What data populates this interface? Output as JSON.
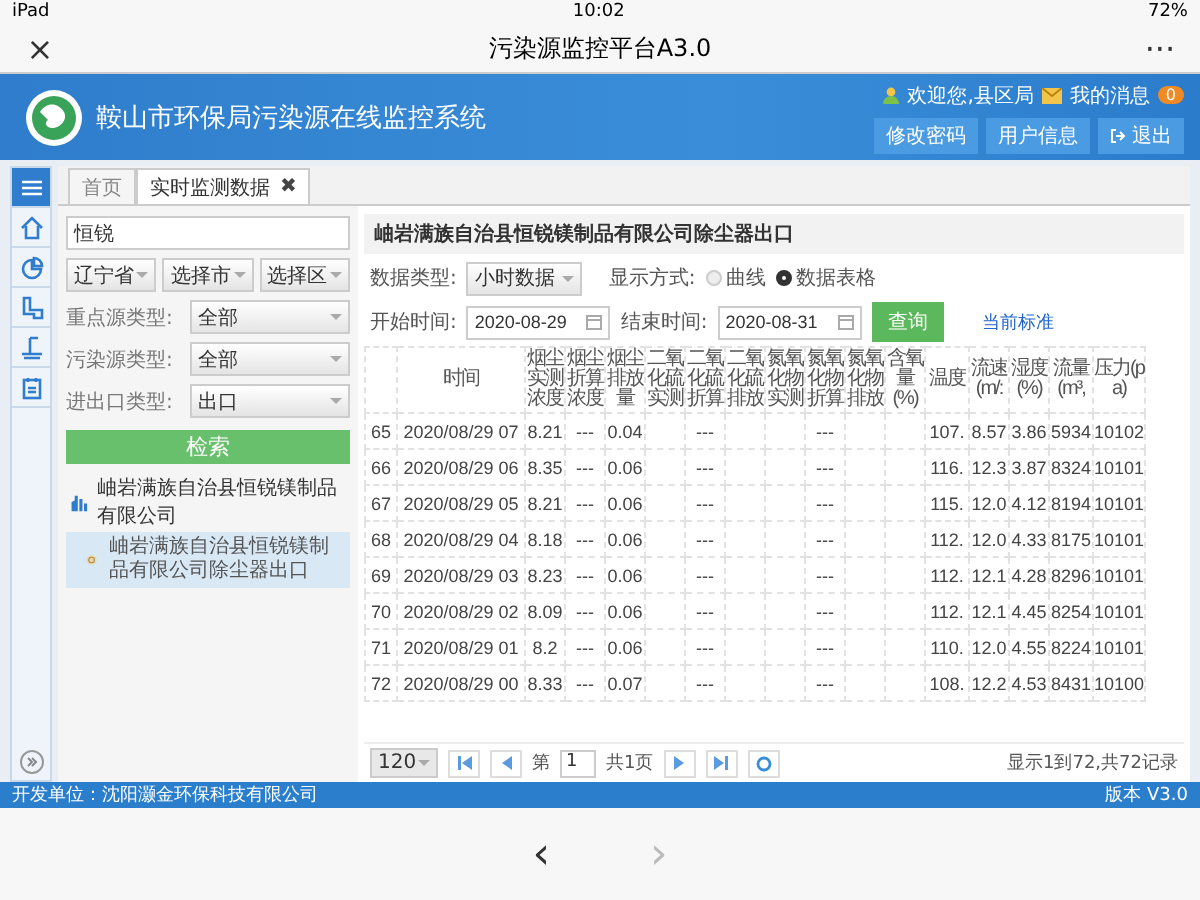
{
  "status_bar": {
    "device": "iPad",
    "time": "10:02",
    "battery": "72%"
  },
  "nav_bar": {
    "close": "×",
    "title": "污染源监控平台A3.0",
    "more": "···"
  },
  "header": {
    "title": "鞍山市环保局污染源在线监控系统",
    "welcome": "欢迎您,县区局",
    "messages": "我的消息",
    "message_count": "0",
    "buttons": [
      {
        "label": "修改密码",
        "kind": "plain"
      },
      {
        "label": "用户信息",
        "kind": "plain"
      },
      {
        "label": "退出",
        "kind": "logout"
      }
    ]
  },
  "rail": [
    {
      "kind": "menu",
      "selected": true
    },
    {
      "kind": "home",
      "selected": false
    },
    {
      "kind": "chart",
      "selected": false
    },
    {
      "kind": "pipe",
      "selected": false
    },
    {
      "kind": "flow",
      "selected": false
    },
    {
      "kind": "calendar",
      "selected": false
    }
  ],
  "tabs": [
    {
      "label": "首页",
      "selected": false
    },
    {
      "label": "实时监测数据",
      "selected": true,
      "close": "✖"
    }
  ],
  "filter": {
    "search": "恒锐",
    "region": [
      "辽宁省",
      "选择市",
      "选择区"
    ],
    "fields": [
      {
        "label": "重点源类型:",
        "value": "全部"
      },
      {
        "label": "污染源类型:",
        "value": "全部"
      },
      {
        "label": "进出口类型:",
        "value": "出口"
      }
    ],
    "button": "检索"
  },
  "tree": [
    {
      "label": "岫岩满族自治县恒锐镁制品有限公司",
      "children": [
        {
          "label": "岫岩满族自治县恒锐镁制品有限公司除尘器出口",
          "selected": true
        }
      ]
    }
  ],
  "panel_title": "岫岩满族自治县恒锐镁制品有限公司除尘器出口",
  "data_type": {
    "label": "数据类型:",
    "value": "小时数据"
  },
  "display": {
    "label": "显示方式:",
    "options": [
      {
        "label": "曲线",
        "selected": false
      },
      {
        "label": "数据表格",
        "selected": true
      }
    ]
  },
  "start": {
    "label": "开始时间:",
    "value": "2020-08-29"
  },
  "end": {
    "label": "结束时间:",
    "value": "2020-08-31"
  },
  "query": "查询",
  "standard_link": "当前标准",
  "table": {
    "columns": [
      "时间",
      "烟尘实测浓度",
      "烟尘折算浓度",
      "烟尘排放量",
      "二氧化硫实测",
      "二氧化硫折算",
      "二氧化硫排放",
      "氮氧化物实测",
      "氮氧化物折算",
      "氮氧化物排放",
      "含氧量(%)",
      "温度",
      "流速(m/:",
      "湿度(%)",
      "流量(m³,",
      "压力(pa)"
    ],
    "rows": [
      {
        "index": "65",
        "cells": [
          "2020/08/29 07",
          "8.21",
          "---",
          "0.04",
          null,
          "---",
          null,
          null,
          "---",
          null,
          null,
          "107.",
          "8.57",
          "3.86",
          "5934",
          "10102"
        ]
      },
      {
        "index": "66",
        "cells": [
          "2020/08/29 06",
          "8.35",
          "---",
          "0.06",
          null,
          "---",
          null,
          null,
          "---",
          null,
          null,
          "116.",
          "12.3",
          "3.87",
          "8324",
          "10101"
        ]
      },
      {
        "index": "67",
        "cells": [
          "2020/08/29 05",
          "8.21",
          "---",
          "0.06",
          null,
          "---",
          null,
          null,
          "---",
          null,
          null,
          "115.",
          "12.0",
          "4.12",
          "8194",
          "10101"
        ]
      },
      {
        "index": "68",
        "cells": [
          "2020/08/29 04",
          "8.18",
          "---",
          "0.06",
          null,
          "---",
          null,
          null,
          "---",
          null,
          null,
          "112.",
          "12.0",
          "4.33",
          "8175",
          "10101"
        ]
      },
      {
        "index": "69",
        "cells": [
          "2020/08/29 03",
          "8.23",
          "---",
          "0.06",
          null,
          "---",
          null,
          null,
          "---",
          null,
          null,
          "112.",
          "12.1",
          "4.28",
          "8296",
          "10101"
        ]
      },
      {
        "index": "70",
        "cells": [
          "2020/08/29 02",
          "8.09",
          "---",
          "0.06",
          null,
          "---",
          null,
          null,
          "---",
          null,
          null,
          "112.",
          "12.1",
          "4.45",
          "8254",
          "10101"
        ]
      },
      {
        "index": "71",
        "cells": [
          "2020/08/29 01",
          "8.2",
          "---",
          "0.06",
          null,
          "---",
          null,
          null,
          "---",
          null,
          null,
          "110.",
          "12.0",
          "4.55",
          "8224",
          "10101"
        ]
      },
      {
        "index": "72",
        "cells": [
          "2020/08/29 00",
          "8.33",
          "---",
          "0.07",
          null,
          "---",
          null,
          null,
          "---",
          null,
          null,
          "108.",
          "12.2",
          "4.53",
          "8431",
          "10100"
        ]
      }
    ]
  },
  "pager": {
    "page_size": "120",
    "page_prefix": "第",
    "page": "1",
    "page_suffix": "共1页",
    "summary": "显示1到72,共72记录"
  },
  "footer": {
    "developer": "开发单位：沈阳灏金环保科技有限公司",
    "version": "版本 V3.0"
  },
  "bottom_nav": {
    "back": "‹",
    "forward": "›"
  }
}
